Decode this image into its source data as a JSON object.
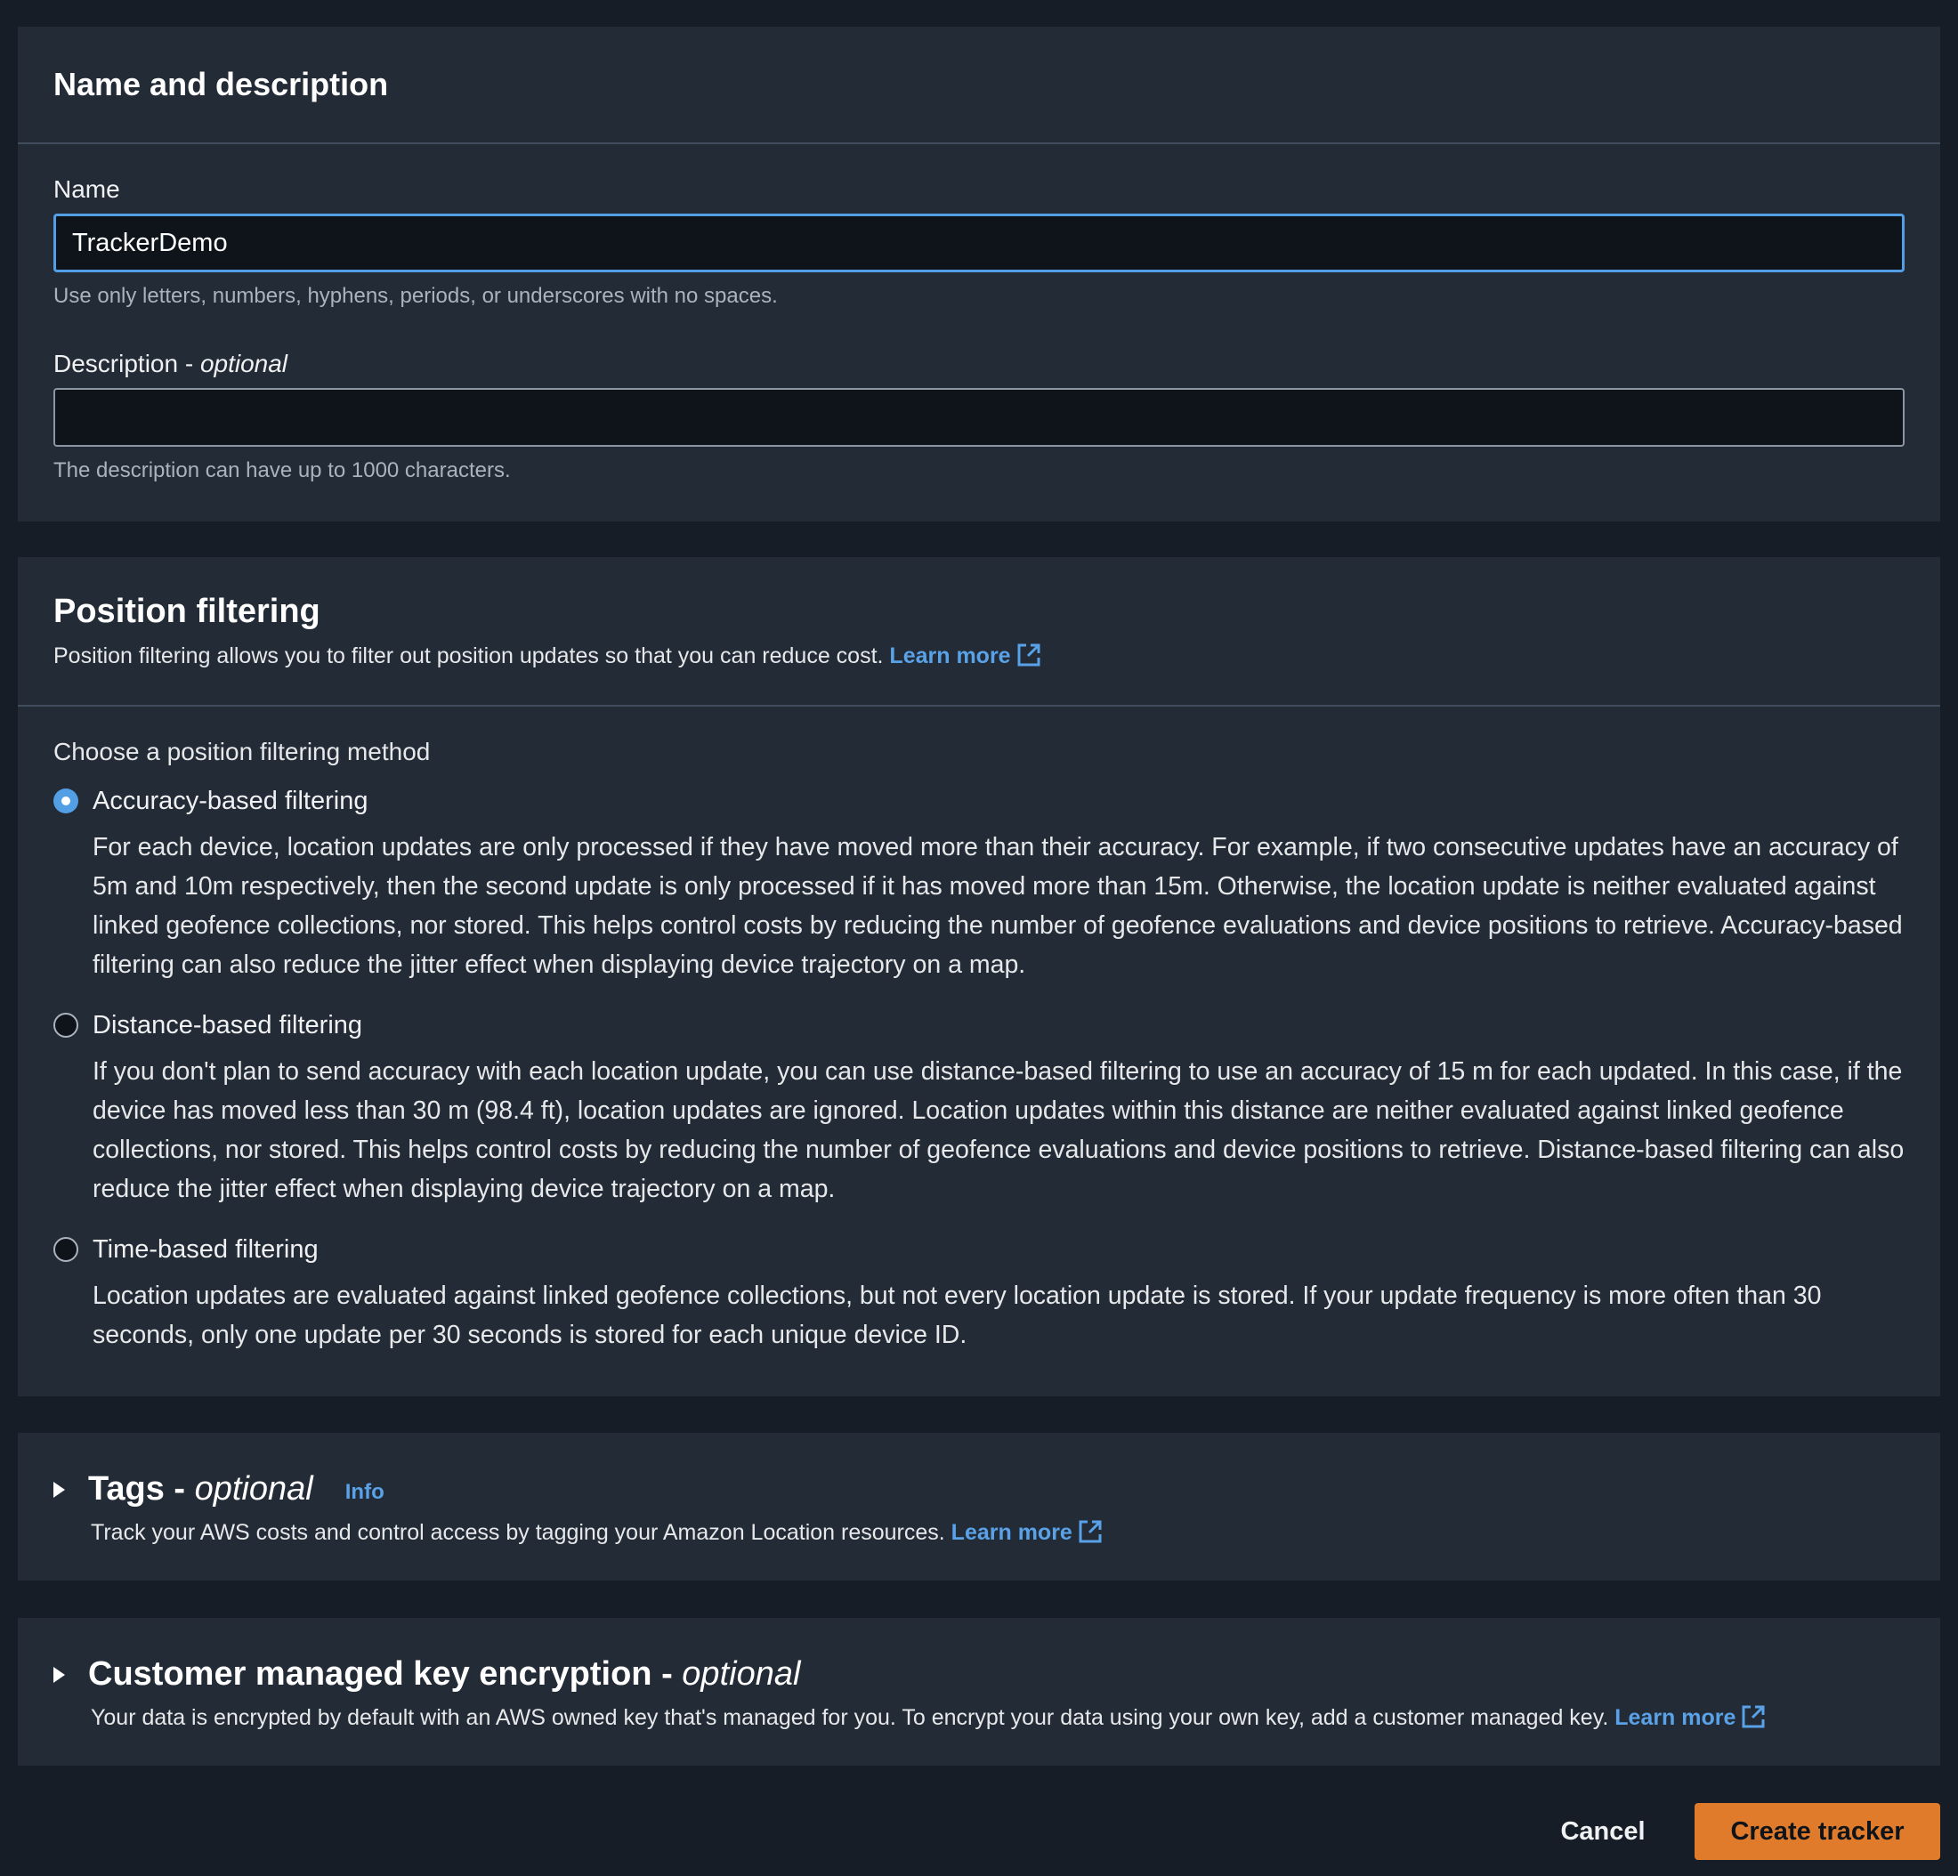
{
  "name_section": {
    "title": "Name and description",
    "name_label": "Name",
    "name_value": "TrackerDemo",
    "name_hint": "Use only letters, numbers, hyphens, periods, or underscores with no spaces.",
    "description_label": "Description - ",
    "description_optional": "optional",
    "description_value": "",
    "description_hint": "The description can have up to 1000 characters."
  },
  "position_section": {
    "title": "Position filtering",
    "subtitle": "Position filtering allows you to filter out position updates so that you can reduce cost. ",
    "learn_more": "Learn more",
    "group_label": "Choose a position filtering method",
    "options": [
      {
        "label": "Accuracy-based filtering",
        "checked": true,
        "description": "For each device, location updates are only processed if they have moved more than their accuracy. For example, if two consecutive updates have an accuracy of 5m and 10m respectively, then the second update is only processed if it has moved more than 15m. Otherwise, the location update is neither evaluated against linked geofence collections, nor stored. This helps control costs by reducing the number of geofence evaluations and device positions to retrieve. Accuracy-based filtering can also reduce the jitter effect when displaying device trajectory on a map."
      },
      {
        "label": "Distance-based filtering",
        "checked": false,
        "description": "If you don't plan to send accuracy with each location update, you can use distance-based filtering to use an accuracy of 15 m for each updated. In this case, if the device has moved less than 30 m (98.4 ft), location updates are ignored. Location updates within this distance are neither evaluated against linked geofence collections, nor stored. This helps control costs by reducing the number of geofence evaluations and device positions to retrieve. Distance-based filtering can also reduce the jitter effect when displaying device trajectory on a map."
      },
      {
        "label": "Time-based filtering",
        "checked": false,
        "description": "Location updates are evaluated against linked geofence collections, but not every location update is stored. If your update frequency is more often than 30 seconds, only one update per 30 seconds is stored for each unique device ID."
      }
    ]
  },
  "tags_section": {
    "title": "Tags - ",
    "optional": "optional",
    "info": "Info",
    "description": "Track your AWS costs and control access by tagging your Amazon Location resources. ",
    "learn_more": "Learn more"
  },
  "kms_section": {
    "title": "Customer managed key encryption - ",
    "optional": "optional",
    "description": "Your data is encrypted by default with an AWS owned key that's managed for you. To encrypt your data using your own key, add a customer managed key. ",
    "learn_more": "Learn more"
  },
  "footer": {
    "cancel": "Cancel",
    "create": "Create tracker"
  },
  "colors": {
    "background": "#161d26",
    "panel": "#232b37",
    "focus_border": "#539fe5",
    "link": "#5aa2e8",
    "primary_button": "#e07b2c"
  },
  "icons": [
    "external-link-icon",
    "caret-right-icon",
    "radio-icon"
  ]
}
